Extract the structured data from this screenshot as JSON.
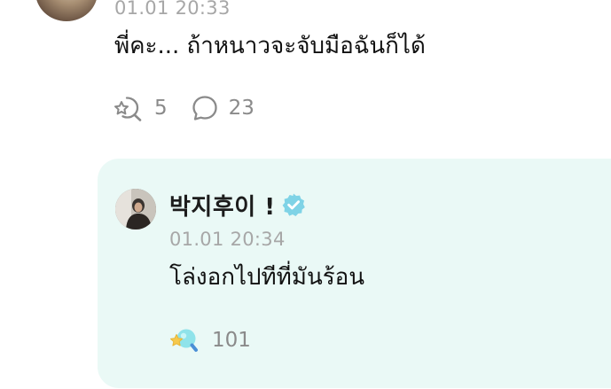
{
  "post": {
    "timestamp": "01.01 20:33",
    "text": "พี่คะ... ถ้าหนาวจะจับมือฉันก็ได้",
    "reaction_count": "5",
    "comment_count": "23"
  },
  "reply": {
    "author": "박지후이 !",
    "timestamp": "01.01 20:34",
    "text": "โล่งอกไปทีที่มันร้อน",
    "reaction_count": "101"
  },
  "colors": {
    "card_background": "#eaf9f6",
    "verified_badge": "#7fd3e6",
    "timestamp_gray": "#a7a7a7",
    "icon_gray": "#8a8a8a"
  },
  "icons": {
    "post_reaction": "sparkle-reaction-icon",
    "post_comment": "comment-bubble-icon",
    "verified": "verified-badge-icon",
    "reply_reaction": "colored-reaction-icon"
  }
}
